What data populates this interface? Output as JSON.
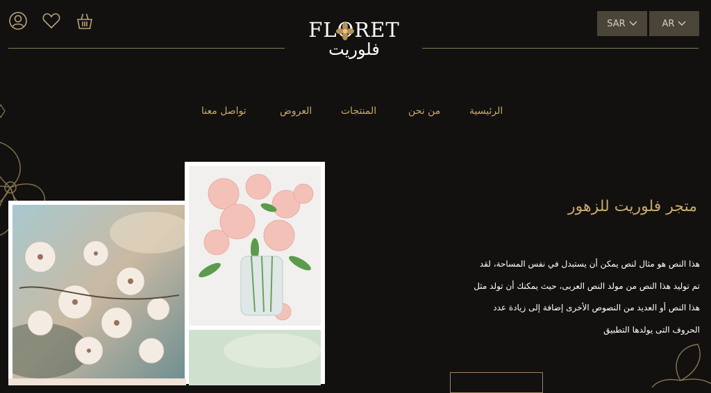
{
  "header": {
    "logo_en": "FLORET",
    "logo_ar": "فلوريت",
    "currency": "SAR",
    "language": "AR",
    "icons": [
      "user-icon",
      "heart-icon",
      "basket-icon",
      "chevron-down-icon"
    ]
  },
  "nav": {
    "items": [
      {
        "label": "الرئيسية"
      },
      {
        "label": "من نحن"
      },
      {
        "label": "المنتجات"
      },
      {
        "label": "العروض"
      },
      {
        "label": "تواصل معنا"
      }
    ]
  },
  "hero": {
    "title": "متجر فلوريت للزهور",
    "lines": [
      "هذا النص هو مثال لنص يمكن أن يستبدل في نفس المساحة، لقد",
      "تم توليد هذا النص من مولد النص العربى، حيث يمكنك أن تولد مثل",
      "هذا النص أو العديد من النصوص الأخرى إضافة إلى زيادة عدد",
      "الحروف التى يولدها التطبيق"
    ]
  },
  "colors": {
    "background": "#121110",
    "accent": "#c9a96a",
    "selector_bg": "#4a4538"
  }
}
